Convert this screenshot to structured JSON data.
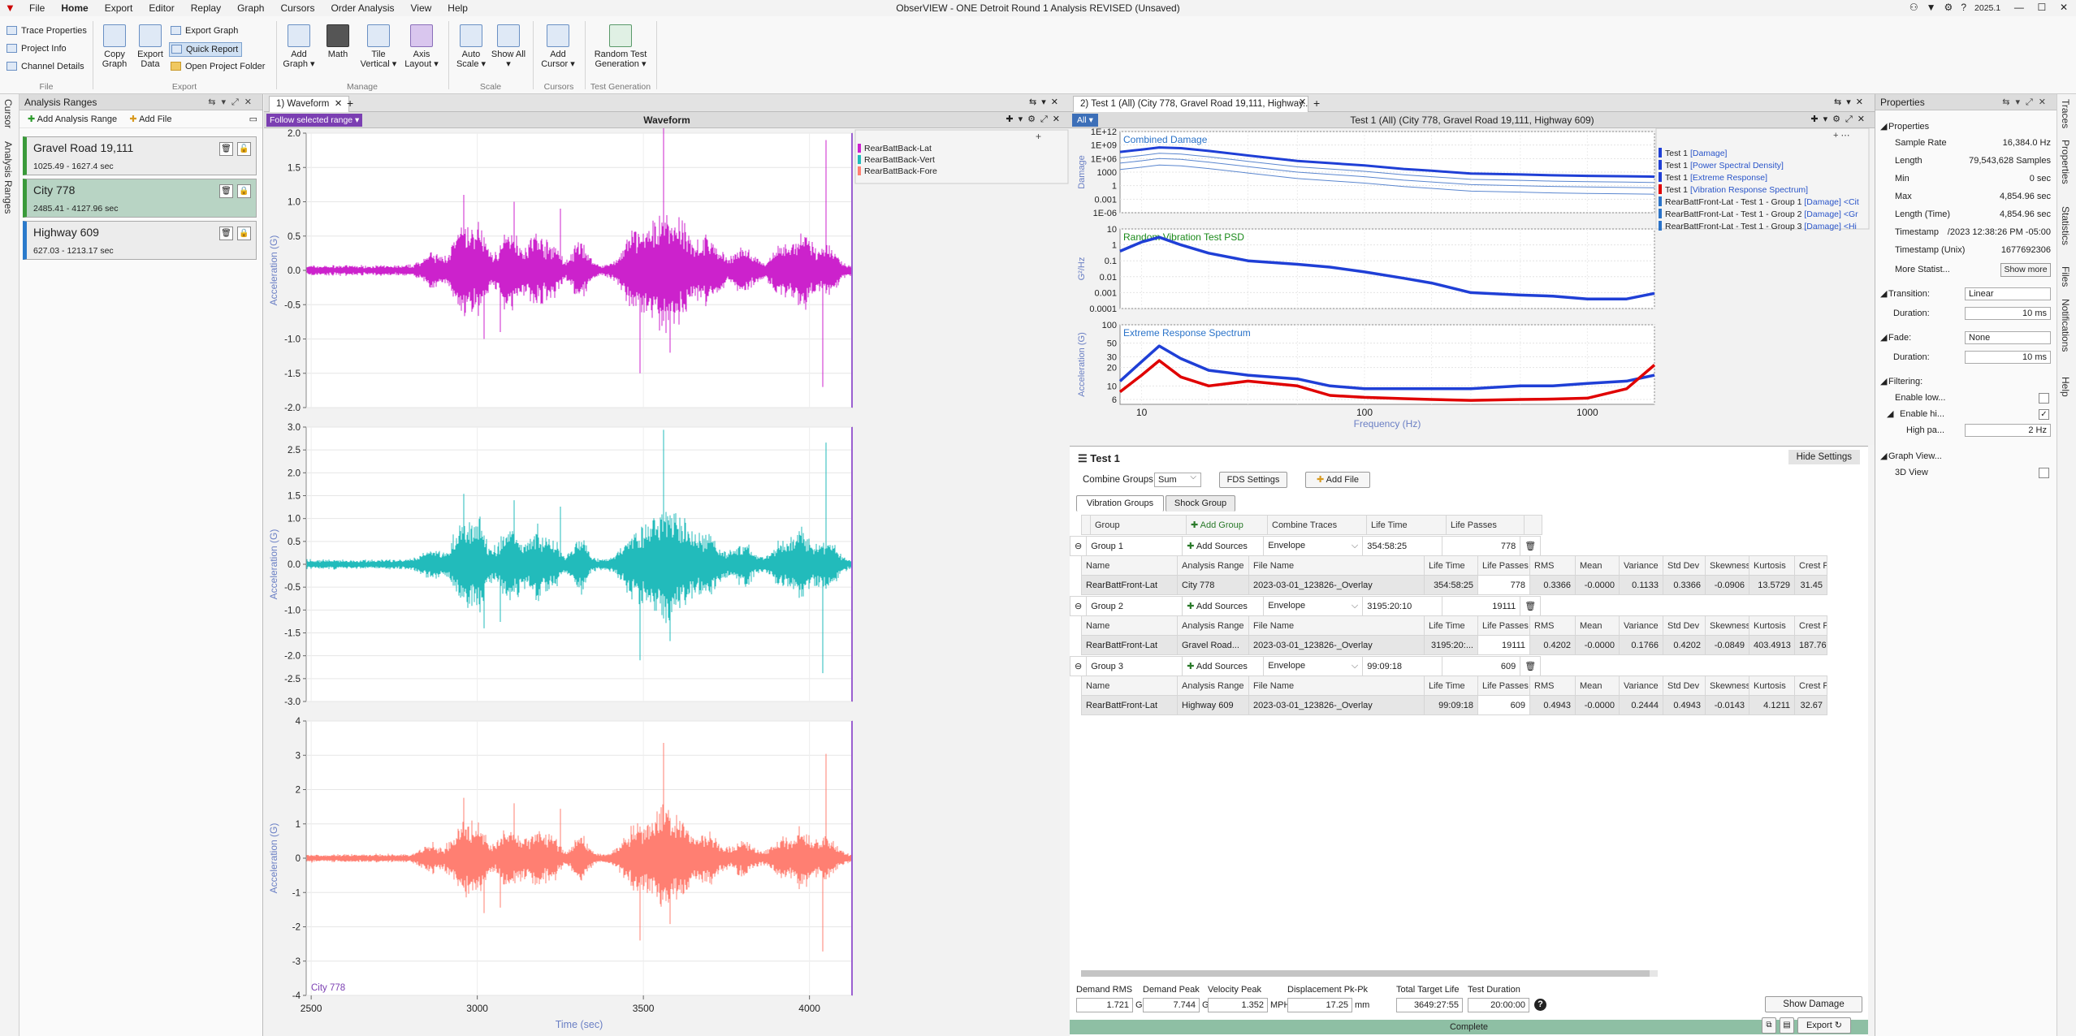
{
  "app": {
    "title": "ObserVIEW - ONE Detroit Round 1 Analysis REVISED (Unsaved)",
    "version": "2025.1",
    "menu": [
      "File",
      "Home",
      "Export",
      "Editor",
      "Replay",
      "Graph",
      "Cursors",
      "Order Analysis",
      "View",
      "Help"
    ]
  },
  "ribbon": {
    "file_rows": [
      "Trace Properties",
      "Project Info",
      "Channel Details"
    ],
    "export_buttons": [
      "Copy Graph",
      "Export Data"
    ],
    "export_rows": [
      "Export Graph",
      "Quick Report",
      "Open Project Folder"
    ],
    "manage_buttons": [
      "Add Graph ▾",
      "Math",
      "Tile Vertical ▾",
      "Axis Layout ▾"
    ],
    "scale_buttons": [
      "Auto Scale ▾",
      "Show All ▾"
    ],
    "cursor_buttons": [
      "Add Cursor ▾"
    ],
    "testgen_buttons": [
      "Random Test Generation ▾"
    ],
    "groups": [
      "File",
      "Export",
      "Manage",
      "Scale",
      "Cursors",
      "Test Generation"
    ]
  },
  "left_tabs": [
    "Cursor",
    "Analysis Ranges"
  ],
  "right_tabs": [
    "Traces",
    "Properties",
    "Statistics",
    "Files",
    "Notifications",
    "Help"
  ],
  "ranges_panel": {
    "title": "Analysis Ranges",
    "add_range": "Add Analysis Range",
    "add_file": "Add File",
    "items": [
      {
        "name": "Gravel Road 19,111",
        "span": "1025.49 - 1627.4 sec",
        "color": "#3a9a3a"
      },
      {
        "name": "City 778",
        "span": "2485.41 - 4127.96 sec",
        "color": "#3a9a3a"
      },
      {
        "name": "Highway 609",
        "span": "627.03 - 1213.17 sec",
        "color": "#2a7acb"
      }
    ]
  },
  "waveform": {
    "tab": "1) Waveform",
    "follow": "Follow selected range ▾",
    "title": "Waveform",
    "legend": [
      {
        "name": "RearBattBack-Lat",
        "color": "#cc22cc"
      },
      {
        "name": "RearBattBack-Vert",
        "color": "#22bbbb"
      },
      {
        "name": "RearBattBack-Fore",
        "color": "#ff7f72"
      }
    ],
    "ylabel": "Acceleration (G)",
    "xlabel": "Time (sec)",
    "range_label": "City 778",
    "xticks": [
      "2500",
      "3000",
      "3500",
      "4000"
    ],
    "x_range": [
      2485,
      4128
    ],
    "panes": [
      {
        "yticks": [
          "2.0",
          "1.5",
          "1.0",
          "0.5",
          "0.0",
          "-0.5",
          "-1.0",
          "-1.5",
          "-2.0"
        ],
        "ylim": [
          -2.0,
          2.0
        ],
        "color": "#cc22cc"
      },
      {
        "yticks": [
          "3.0",
          "2.5",
          "2.0",
          "1.5",
          "1.0",
          "0.5",
          "0.0",
          "-0.5",
          "-1.0",
          "-1.5",
          "-2.0",
          "-2.5",
          "-3.0"
        ],
        "ylim": [
          -3.0,
          3.0
        ],
        "color": "#22bbbb"
      },
      {
        "yticks": [
          "4",
          "3",
          "2",
          "1",
          "0",
          "-1",
          "-2",
          "-3",
          "-4"
        ],
        "ylim": [
          -4,
          4
        ],
        "color": "#ff7f72"
      }
    ]
  },
  "analysis": {
    "tab": "2) Test 1 (All) (City 778, Gravel Road 19,111, Highway...",
    "all_label": "All ▾",
    "title": "Test 1 (All) (City 778, Gravel Road 19,111, Highway 609)",
    "legend": [
      {
        "pre": "Test 1 ",
        "tag": "[Damage]",
        "suffix": "",
        "color": "#1f3fd6"
      },
      {
        "pre": "Test 1 ",
        "tag": "[Power Spectral Density]",
        "suffix": "",
        "color": "#1f3fd6"
      },
      {
        "pre": "Test 1 ",
        "tag": "[Extreme Response]",
        "suffix": "",
        "color": "#1f3fd6"
      },
      {
        "pre": "Test 1 ",
        "tag": "[Vibration Response Spectrum]",
        "suffix": "",
        "color": "#e00000"
      },
      {
        "pre": "RearBattFront-Lat - Test 1 - Group 1 ",
        "tag": "[Damage]",
        "suffix": " <Cit",
        "color": "#2a73c9"
      },
      {
        "pre": "RearBattFront-Lat - Test 1 - Group 2 ",
        "tag": "[Damage]",
        "suffix": " <Gr",
        "color": "#2a73c9"
      },
      {
        "pre": "RearBattFront-Lat - Test 1 - Group 3 ",
        "tag": "[Damage]",
        "suffix": " <Hi",
        "color": "#2a73c9"
      }
    ],
    "charts": [
      {
        "title": "Combined Damage",
        "title_color": "#2a73c9",
        "ylabel": "Damage",
        "yticks": [
          "1E+12",
          "1E+09",
          "1E+06",
          "1000",
          "1",
          "0.001",
          "1E-06"
        ]
      },
      {
        "title": "Random Vibration Test PSD",
        "title_color": "#1a8a1a",
        "ylabel": "G²/Hz",
        "yticks": [
          "10",
          "1",
          "0.1",
          "0.01",
          "0.001",
          "0.0001"
        ]
      },
      {
        "title": "Extreme Response Spectrum",
        "title_color": "#2a73c9",
        "ylabel": "Acceleration (G)",
        "yticks": [
          "100",
          "50",
          "30",
          "20",
          "10",
          "6"
        ]
      }
    ],
    "xticks": [
      "10",
      "100",
      "1000"
    ],
    "xlabel": "Frequency (Hz)"
  },
  "chart_data": [
    {
      "type": "line",
      "title": "Combined Damage",
      "ylabel": "Damage",
      "xlabel": "Frequency (Hz)",
      "x_scale": "log",
      "y_scale": "log",
      "xlim": [
        8,
        2000
      ],
      "ylim": [
        1e-06,
        1000000000000.0
      ],
      "series": [
        {
          "x": [
            8,
            10,
            12,
            15,
            20,
            30,
            50,
            70,
            100,
            150,
            200,
            300,
            500,
            700,
            1000,
            1500,
            2000
          ],
          "values": [
            30000000.0,
            100000000.0,
            300000000.0,
            200000000.0,
            50000000.0,
            5000000.0,
            300000.0,
            100000.0,
            30000.0,
            5000.0,
            2000.0,
            500,
            300,
            200,
            150,
            120,
            100
          ]
        }
      ]
    },
    {
      "type": "line",
      "title": "Random Vibration Test PSD",
      "ylabel": "G²/Hz",
      "xlabel": "Frequency (Hz)",
      "x_scale": "log",
      "y_scale": "log",
      "xlim": [
        8,
        2000
      ],
      "ylim": [
        0.0001,
        10
      ],
      "series": [
        {
          "x": [
            8,
            10,
            12,
            15,
            20,
            30,
            50,
            70,
            100,
            150,
            200,
            300,
            500,
            700,
            1000,
            1500,
            2000
          ],
          "values": [
            0.4,
            1.5,
            3,
            1,
            0.3,
            0.1,
            0.06,
            0.04,
            0.02,
            0.008,
            0.004,
            0.001,
            0.0007,
            0.0006,
            0.0004,
            0.0004,
            0.0009
          ]
        }
      ]
    },
    {
      "type": "line",
      "title": "Extreme Response Spectrum",
      "ylabel": "Acceleration (G)",
      "xlabel": "Frequency (Hz)",
      "x_scale": "log",
      "y_scale": "log",
      "xlim": [
        8,
        2000
      ],
      "ylim": [
        5,
        100
      ],
      "series": [
        {
          "x": [
            8,
            10,
            12,
            15,
            20,
            30,
            50,
            70,
            100,
            150,
            200,
            300,
            500,
            700,
            1000,
            1500,
            2000
          ],
          "values": [
            12,
            25,
            45,
            28,
            18,
            15,
            13,
            10,
            9,
            9,
            9,
            9,
            10,
            10,
            11,
            12,
            15
          ],
          "color": "#1f3fd6"
        },
        {
          "x": [
            8,
            10,
            12,
            15,
            20,
            30,
            50,
            70,
            100,
            150,
            200,
            300,
            500,
            700,
            1000,
            1500,
            2000
          ],
          "values": [
            8,
            15,
            26,
            14,
            10,
            12,
            10,
            7,
            6.5,
            6.2,
            6,
            5.8,
            6,
            6.1,
            6.3,
            9,
            22
          ],
          "color": "#e00000"
        }
      ]
    }
  ],
  "test_panel": {
    "title": "Test 1",
    "hide_settings": "Hide Settings",
    "combine_groups_label": "Combine Groups",
    "combine_groups_value": "Sum",
    "fds_settings": "FDS Settings",
    "add_file": "Add File",
    "tabs": [
      "Vibration Groups",
      "Shock Group"
    ],
    "group_header": {
      "group": "Group",
      "add_group": "Add Group",
      "combine": "Combine Traces",
      "life_time": "Life Time",
      "life_passes": "Life Passes"
    },
    "detail_headers": [
      "Name",
      "Analysis Range",
      "File Name",
      "Life Time",
      "Life Passes",
      "RMS",
      "Mean",
      "Variance",
      "Std Dev",
      "Skewness",
      "Kurtosis",
      "Crest F"
    ],
    "add_sources": "Add Sources",
    "groups": [
      {
        "name": "Group 1",
        "combine": "Envelope",
        "life_time": "354:58:25",
        "life_passes": "778",
        "row": [
          "RearBattFront-Lat",
          "City 778",
          "2023-03-01_123826-_Overlay",
          "354:58:25",
          "778",
          "0.3366",
          "-0.0000",
          "0.1133",
          "0.3366",
          "-0.0906",
          "13.5729",
          "31.45"
        ]
      },
      {
        "name": "Group 2",
        "combine": "Envelope",
        "life_time": "3195:20:10",
        "life_passes": "19111",
        "row": [
          "RearBattFront-Lat",
          "Gravel Road...",
          "2023-03-01_123826-_Overlay",
          "3195:20:...",
          "19111",
          "0.4202",
          "-0.0000",
          "0.1766",
          "0.4202",
          "-0.0849",
          "403.4913",
          "187.76"
        ]
      },
      {
        "name": "Group 3",
        "combine": "Envelope",
        "life_time": "99:09:18",
        "life_passes": "609",
        "row": [
          "RearBattFront-Lat",
          "Highway 609",
          "2023-03-01_123826-_Overlay",
          "99:09:18",
          "609",
          "0.4943",
          "-0.0000",
          "0.2444",
          "0.4943",
          "-0.0143",
          "4.1211",
          "32.67"
        ]
      }
    ],
    "summary": [
      {
        "label": "Demand RMS",
        "value": "1.721",
        "unit": "G"
      },
      {
        "label": "Demand Peak",
        "value": "7.744",
        "unit": "G"
      },
      {
        "label": "Velocity Peak",
        "value": "1.352",
        "unit": "MPH"
      },
      {
        "label": "Displacement Pk-Pk",
        "value": "17.25",
        "unit": "mm"
      },
      {
        "label": "Total Target Life",
        "value": "3649:27:55",
        "unit": ""
      },
      {
        "label": "Test Duration",
        "value": "20:00:00",
        "unit": ""
      }
    ],
    "show_damage": "Show Damage",
    "status": "Complete",
    "export": "Export"
  },
  "properties": {
    "title": "Properties",
    "section": "Properties",
    "rows": [
      {
        "k": "Sample Rate",
        "v": "16,384.0 Hz"
      },
      {
        "k": "Length",
        "v": "79,543,628 Samples"
      },
      {
        "k": "Min",
        "v": "0 sec"
      },
      {
        "k": "Max",
        "v": "4,854.96 sec"
      },
      {
        "k": "Length (Time)",
        "v": "4,854.96 sec"
      },
      {
        "k": "Timestamp",
        "v": "/2023 12:38:26 PM -05:00"
      },
      {
        "k": "Timestamp (Unix)",
        "v": "1677692306"
      }
    ],
    "more_stats": "More Statist...",
    "show_more": "Show more",
    "transition_label": "Transition:",
    "transition_value": "Linear",
    "duration_label": "Duration:",
    "duration_value": "10 ms",
    "fade_label": "Fade:",
    "fade_value": "None",
    "fade_duration_value": "10 ms",
    "filtering_label": "Filtering:",
    "enable_low": "Enable low...",
    "enable_high": "Enable hi...",
    "high_pass": "High pa...",
    "high_pass_value": "2 Hz",
    "graph_view": "Graph View...",
    "view_3d": "3D View"
  }
}
